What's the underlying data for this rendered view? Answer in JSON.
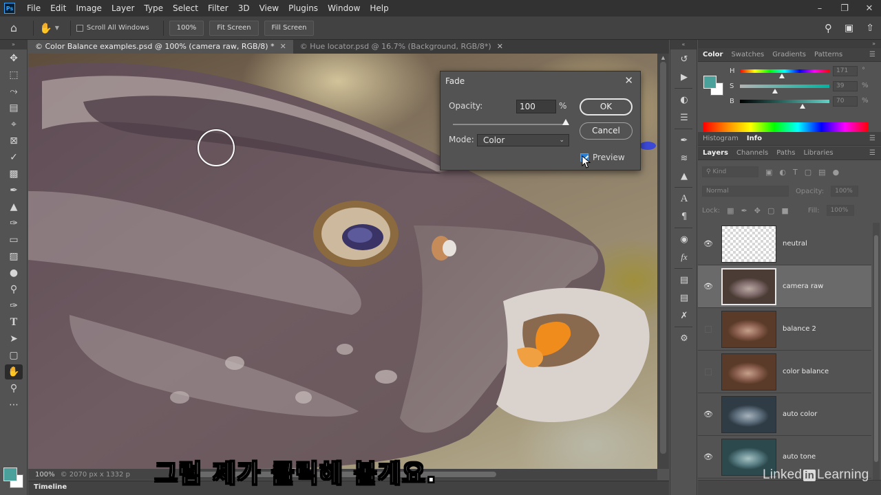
{
  "menubar": {
    "logo": "Ps",
    "items": [
      "File",
      "Edit",
      "Image",
      "Layer",
      "Type",
      "Select",
      "Filter",
      "3D",
      "View",
      "Plugins",
      "Window",
      "Help"
    ],
    "window_controls": [
      "minimize-icon",
      "restore-icon",
      "close-icon"
    ]
  },
  "options_bar": {
    "scroll_all_windows": "Scroll All Windows",
    "zoom_100": "100%",
    "fit_screen": "Fit Screen",
    "fill_screen": "Fill Screen"
  },
  "doc_tabs": [
    {
      "label": "© Color Balance examples.psd @ 100% (camera raw, RGB/8) *",
      "active": true
    },
    {
      "label": "© Hue locator.psd @ 16.7% (Background, RGB/8*)",
      "active": false
    }
  ],
  "status": {
    "zoom": "100%",
    "dims": "2070 px x 1332 p"
  },
  "timeline": {
    "label": "Timeline"
  },
  "fade_dialog": {
    "title": "Fade",
    "opacity_label": "Opacity:",
    "opacity_value": "100",
    "opacity_unit": "%",
    "opacity_fraction": 1.0,
    "mode_label": "Mode:",
    "mode_value": "Color",
    "ok": "OK",
    "cancel": "Cancel",
    "preview_label": "Preview",
    "preview_checked": true
  },
  "color_panel": {
    "tabs": [
      "Color",
      "Swatches",
      "Gradients",
      "Patterns"
    ],
    "foreground": "#4aa09a",
    "background": "#ffffff",
    "h": {
      "letter": "H",
      "value": "171",
      "unit": "°",
      "position": 0.47
    },
    "s": {
      "letter": "S",
      "value": "39",
      "unit": "%",
      "position": 0.39
    },
    "b": {
      "letter": "B",
      "value": "70",
      "unit": "%",
      "position": 0.7
    }
  },
  "histogram_tabs": [
    "Histogram",
    "Info"
  ],
  "layers_panel": {
    "tabs": [
      "Layers",
      "Channels",
      "Paths",
      "Libraries"
    ],
    "filter_label": "Kind",
    "blend_mode": "Normal",
    "opacity_label": "Opacity:",
    "opacity_value": "100%",
    "lock_label": "Lock:",
    "fill_label": "Fill:",
    "fill_value": "100%",
    "layers": [
      {
        "name": "neutral",
        "visible": true,
        "selected": false,
        "thumb": "checker"
      },
      {
        "name": "camera raw",
        "visible": true,
        "selected": true,
        "thumb": "fish"
      },
      {
        "name": "balance 2",
        "visible": false,
        "selected": false,
        "thumb": "fish-warm"
      },
      {
        "name": "color balance",
        "visible": false,
        "selected": false,
        "thumb": "fish-warm"
      },
      {
        "name": "auto color",
        "visible": true,
        "selected": false,
        "thumb": "fish-cool"
      },
      {
        "name": "auto tone",
        "visible": true,
        "selected": false,
        "thumb": "fish-teal"
      }
    ]
  },
  "watermark": {
    "pre": "Linked",
    "in": "in",
    "post": " Learning"
  },
  "subtitle": "그럼 제가 클릭해 볼게요."
}
